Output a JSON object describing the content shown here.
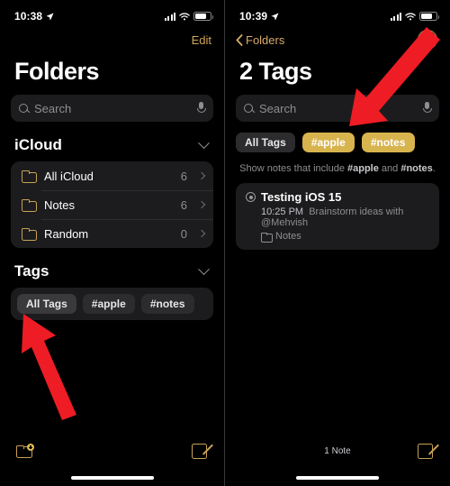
{
  "left_panel": {
    "status": {
      "time": "10:38",
      "location_icon": "location-arrow-icon",
      "signal_icon": "cellular-signal-icon",
      "wifi_icon": "wifi-icon",
      "battery_icon": "battery-icon"
    },
    "nav": {
      "edit_label": "Edit"
    },
    "title": "Folders",
    "search": {
      "placeholder": "Search",
      "search_icon": "search-icon",
      "mic_icon": "microphone-icon"
    },
    "icloud_section": {
      "header": "iCloud",
      "collapse_icon": "chevron-down-icon",
      "folders": [
        {
          "name": "All iCloud",
          "count": "6",
          "icon": "folder-icon",
          "chevron": "chevron-right-icon"
        },
        {
          "name": "Notes",
          "count": "6",
          "icon": "folder-icon",
          "chevron": "chevron-right-icon"
        },
        {
          "name": "Random",
          "count": "0",
          "icon": "folder-icon",
          "chevron": "chevron-right-icon"
        }
      ]
    },
    "tags_section": {
      "header": "Tags",
      "collapse_icon": "chevron-down-icon",
      "tags": [
        {
          "label": "All Tags",
          "selected": true
        },
        {
          "label": "#apple",
          "selected": false
        },
        {
          "label": "#notes",
          "selected": false
        }
      ]
    },
    "toolbar": {
      "new_folder_icon": "new-folder-icon",
      "compose_icon": "compose-note-icon"
    }
  },
  "right_panel": {
    "status": {
      "time": "10:39",
      "location_icon": "location-arrow-icon",
      "signal_icon": "cellular-signal-icon",
      "wifi_icon": "wifi-icon",
      "battery_icon": "battery-icon"
    },
    "nav": {
      "back_label": "Folders",
      "back_icon": "chevron-left-icon",
      "more_icon": "more-options-icon",
      "more_glyph": "•••"
    },
    "title": "2 Tags",
    "search": {
      "placeholder": "Search",
      "search_icon": "search-icon",
      "mic_icon": "microphone-icon"
    },
    "tags": [
      {
        "label": "All Tags",
        "selected": false
      },
      {
        "label": "#apple",
        "selected": true
      },
      {
        "label": "#notes",
        "selected": true
      }
    ],
    "hint": {
      "prefix": "Show notes that include ",
      "tag_one": "#apple",
      "middle": " and ",
      "tag_two": "#notes",
      "suffix": "."
    },
    "notes": [
      {
        "title": "Testing iOS 15",
        "time": "10:25 PM",
        "preview": "Brainstorm ideas with @Mehvish",
        "folder": "Notes",
        "shared_icon": "shared-note-icon",
        "folder_icon": "folder-icon"
      }
    ],
    "toolbar": {
      "count_label": "1 Note",
      "compose_icon": "compose-note-icon"
    }
  },
  "annotations": {
    "arrow_color": "#ee1c24",
    "left_arrow": "red-arrow-pointing-to-all-tags",
    "right_arrow": "red-arrow-pointing-to-selected-tags"
  },
  "colors": {
    "background": "#000000",
    "card": "#1c1c1e",
    "accent_gold": "#c8a255",
    "selected_tag": "#d8b44e",
    "secondary_text": "#8e8e93"
  }
}
